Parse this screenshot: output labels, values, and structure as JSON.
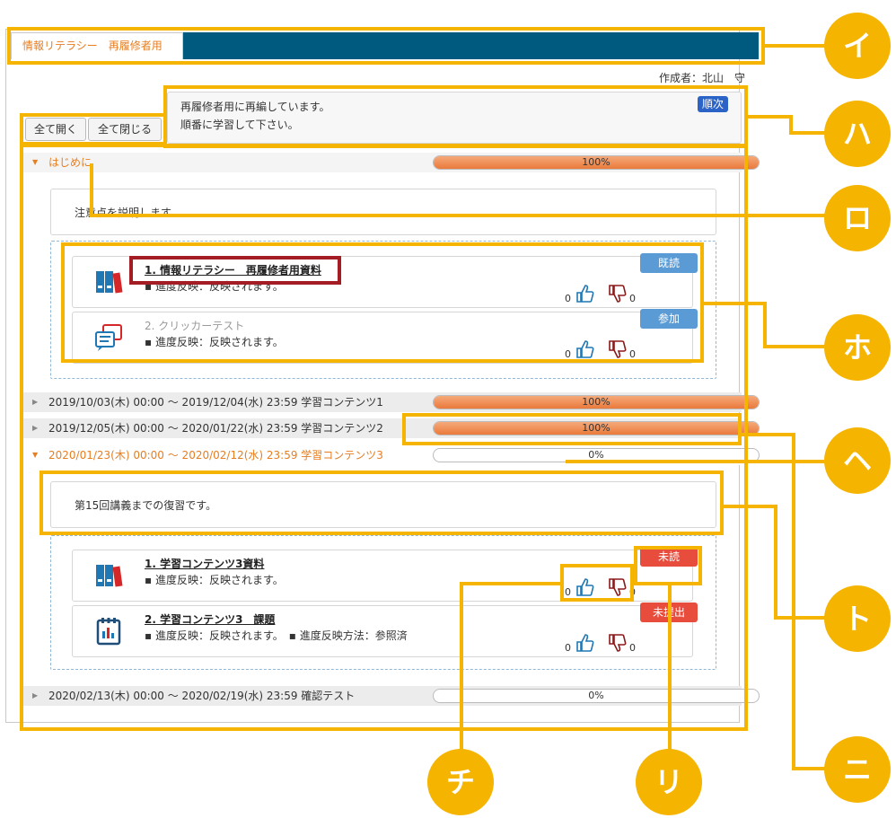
{
  "tab": {
    "label": "情報リテラシー　再履修者用"
  },
  "creator": "作成者：北山　守",
  "buttons": {
    "expand_all": "全て開く",
    "collapse_all": "全て閉じる"
  },
  "description": {
    "line1": "再履修者用に再編しています。",
    "line2": "順番に学習して下さい。",
    "badge": "順次"
  },
  "sections": [
    {
      "label": "はじめに",
      "progress": "100%",
      "progress_value": 100,
      "open": true
    },
    {
      "label": "2019/10/03(木) 00:00 ～ 2019/12/04(水) 23:59 学習コンテンツ1",
      "progress": "100%",
      "progress_value": 100,
      "open": false
    },
    {
      "label": "2019/12/05(木) 00:00 ～ 2020/01/22(水) 23:59 学習コンテンツ2",
      "progress": "100%",
      "progress_value": 100,
      "open": false
    },
    {
      "label": "2020/01/23(木) 00:00 ～ 2020/02/12(水) 23:59 学習コンテンツ3",
      "progress": "0%",
      "progress_value": 0,
      "open": true
    },
    {
      "label": "2020/02/13(木) 00:00 ～ 2020/02/19(水) 23:59 確認テスト",
      "progress": "0%",
      "progress_value": 0,
      "open": false
    }
  ],
  "notes": {
    "intro": "注意点を説明します。",
    "content3": "第15回講義までの復習です。"
  },
  "items": [
    {
      "title": "1. 情報リテラシー　再履修者用資料",
      "meta": "▪ 進度反映：反映されます。",
      "badge": "既読",
      "badge_color": "#5b9bd5",
      "likes": "0",
      "dislikes": "0",
      "icon": "books-icon"
    },
    {
      "title": "2. クリッカーテスト",
      "meta": "▪ 進度反映：反映されます。",
      "badge": "参加",
      "badge_color": "#5b9bd5",
      "likes": "0",
      "dislikes": "0",
      "icon": "chat-icon"
    },
    {
      "title": "1. 学習コンテンツ3資料",
      "meta": "▪ 進度反映：反映されます。",
      "badge": "未読",
      "badge_color": "#e74c3c",
      "likes": "0",
      "dislikes": "0",
      "icon": "books-icon"
    },
    {
      "title": "2. 学習コンテンツ3　課題",
      "meta": "▪ 進度反映：反映されます。　▪ 進度反映方法：参照済",
      "badge": "未提出",
      "badge_color": "#e74c3c",
      "likes": "0",
      "dislikes": "0",
      "icon": "assignment-icon"
    }
  ],
  "callouts": [
    "イ",
    "ハ",
    "ロ",
    "ホ",
    "ヘ",
    "ト",
    "ニ",
    "チ",
    "リ"
  ],
  "colors": {
    "accent": "#f5b400",
    "header": "#005a80",
    "orange": "#e67e22",
    "red": "#a51d24"
  }
}
